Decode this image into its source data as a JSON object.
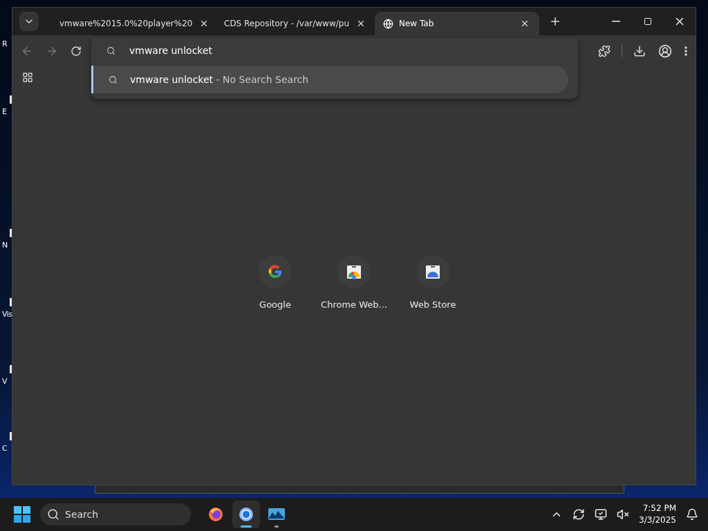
{
  "desktop": {
    "icon_labels": [
      "R",
      "E",
      "N",
      "Vis",
      "V",
      "C"
    ]
  },
  "browser": {
    "tabs": [
      {
        "title": "vmware%2015.0%20player%20",
        "selected": false
      },
      {
        "title": "CDS Repository - /var/www/pu",
        "selected": false
      },
      {
        "title": "New Tab",
        "selected": true
      }
    ],
    "omnibox": {
      "value": "vmware unlocket",
      "suggestions": [
        {
          "query": "vmware unlocket",
          "separator": "-",
          "detail": "No Search Search",
          "selected": true
        }
      ]
    },
    "shortcuts": [
      {
        "label": "Google",
        "kind": "google"
      },
      {
        "label": "Chrome Web...",
        "kind": "store"
      },
      {
        "label": "Web Store",
        "kind": "store-blue"
      }
    ]
  },
  "taskbar": {
    "search_placeholder": "Search",
    "apps": [
      {
        "kind": "firefox",
        "selected": false
      },
      {
        "kind": "chrome",
        "selected": true
      },
      {
        "kind": "monitor",
        "selected": false
      }
    ],
    "time": "7:52 PM",
    "date": "3/3/2025"
  }
}
